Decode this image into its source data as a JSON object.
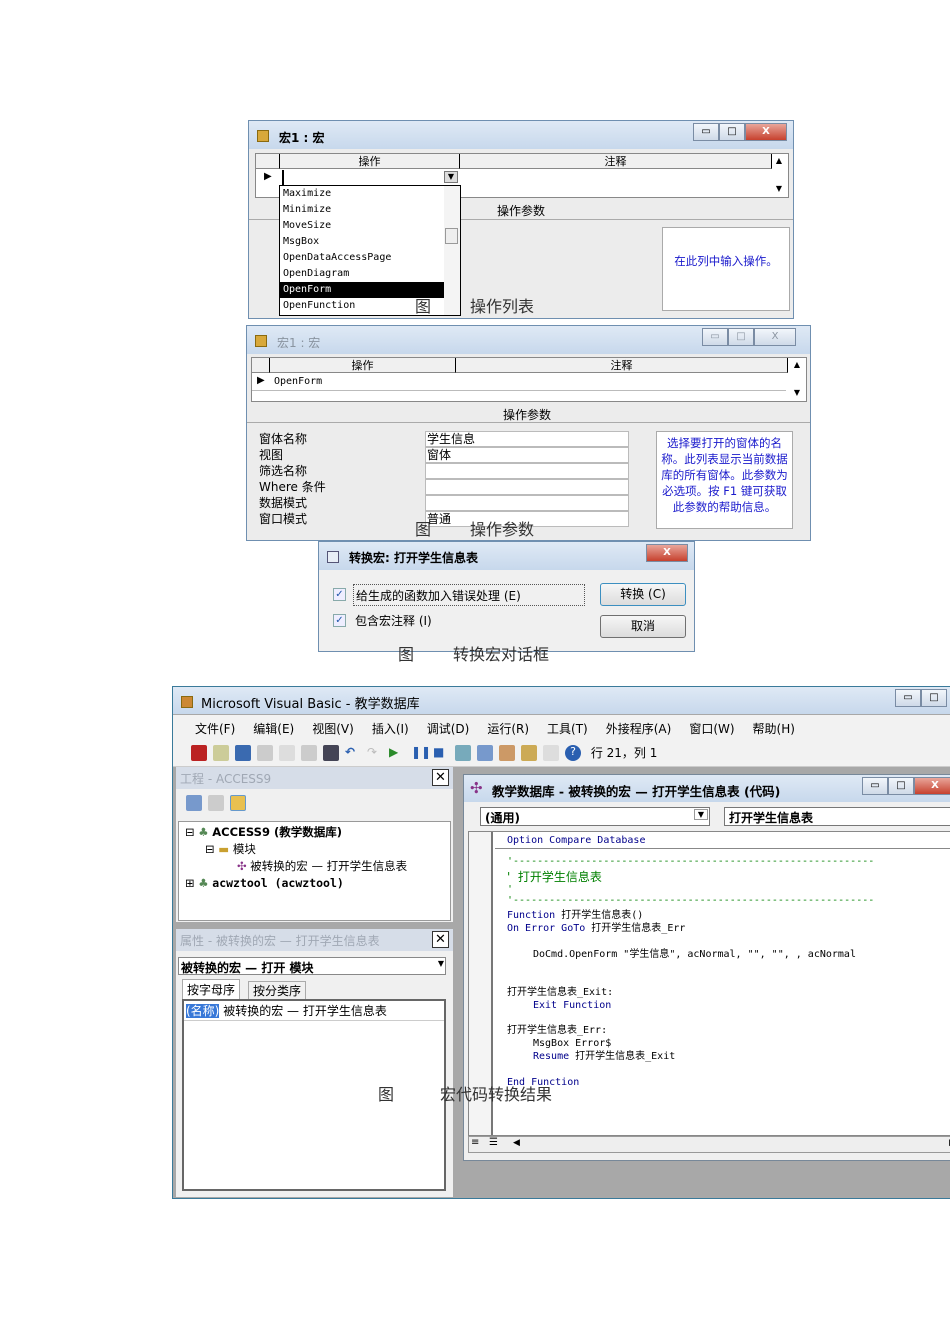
{
  "fig1": {
    "title": "宏1 : 宏",
    "col_action": "操作",
    "col_comment": "注释",
    "params_label": "操作参数",
    "list_items": [
      "Maximize",
      "Minimize",
      "MoveSize",
      "MsgBox",
      "OpenDataAccessPage",
      "OpenDiagram",
      "OpenForm",
      "OpenFunction"
    ],
    "selected_index": 6,
    "help": "在此列中输入操作。",
    "caption_fig": "图",
    "caption": "操作列表"
  },
  "fig2": {
    "title": "宏1 : 宏",
    "col_action": "操作",
    "col_comment": "注释",
    "row_action": "OpenForm",
    "params_label": "操作参数",
    "params": [
      {
        "label": "窗体名称",
        "value": "学生信息"
      },
      {
        "label": "视图",
        "value": "窗体"
      },
      {
        "label": "筛选名称",
        "value": ""
      },
      {
        "label": "Where 条件",
        "value": ""
      },
      {
        "label": "数据模式",
        "value": ""
      },
      {
        "label": "窗口模式",
        "value": "普通"
      }
    ],
    "help": "选择要打开的窗体的名称。此列表显示当前数据库的所有窗体。此参数为必选项。按 F1 键可获取此参数的帮助信息。",
    "caption_fig": "图",
    "caption": "操作参数"
  },
  "fig3": {
    "title": "转换宏: 打开学生信息表",
    "opt1": "给生成的函数加入错误处理 (E)",
    "opt2": "包含宏注释 (I)",
    "opt1_checked": true,
    "opt2_checked": true,
    "convert": "转换 (C)",
    "cancel": "取消",
    "caption_fig": "图",
    "caption": "转换宏对话框"
  },
  "vb": {
    "title": "Microsoft Visual Basic - 教学数据库",
    "menu": [
      "文件(F)",
      "编辑(E)",
      "视图(V)",
      "插入(I)",
      "调试(D)",
      "运行(R)",
      "工具(T)",
      "外接程序(A)",
      "窗口(W)",
      "帮助(H)"
    ],
    "position": "行 21，列 1",
    "project_title": "工程 - ACCESS9",
    "tree": [
      "ACCESS9 (教学数据库)",
      "模块",
      "被转换的宏 — 打开学生信息表",
      "acwztool (acwztool)"
    ],
    "props_title": "属性 - 被转换的宏 — 打开学生信息表",
    "props_object": "被转换的宏 — 打开 模块",
    "tab_alpha": "按字母序",
    "tab_cat": "按分类序",
    "prop_name": "(名称)",
    "prop_value": "被转换的宏 — 打开学生信息表",
    "code_title": "教学数据库 - 被转换的宏 — 打开学生信息表 (代码)",
    "combo_left": "(通用)",
    "combo_right": "打开学生信息表",
    "code": {
      "l1": "Option Compare Database",
      "dash": "'------------------------------------------------------------",
      "c1": "'  打开学生信息表",
      "c2": "'",
      "f1": "Function",
      "f1b": " 打开学生信息表()",
      "o1": "On Error GoTo",
      "o1b": " 打开学生信息表_Err",
      "d1": "DoCmd.OpenForm \"学生信息\", acNormal, \"\", \"\", , acNormal",
      "e1": "打开学生信息表_Exit:",
      "e2": "Exit Function",
      "r1": "打开学生信息表_Err:",
      "r2": "MsgBox Error$",
      "r3": "Resume",
      "r3b": " 打开学生信息表_Exit",
      "end": "End Function"
    },
    "caption_fig": "图",
    "caption": "宏代码转换结果"
  }
}
